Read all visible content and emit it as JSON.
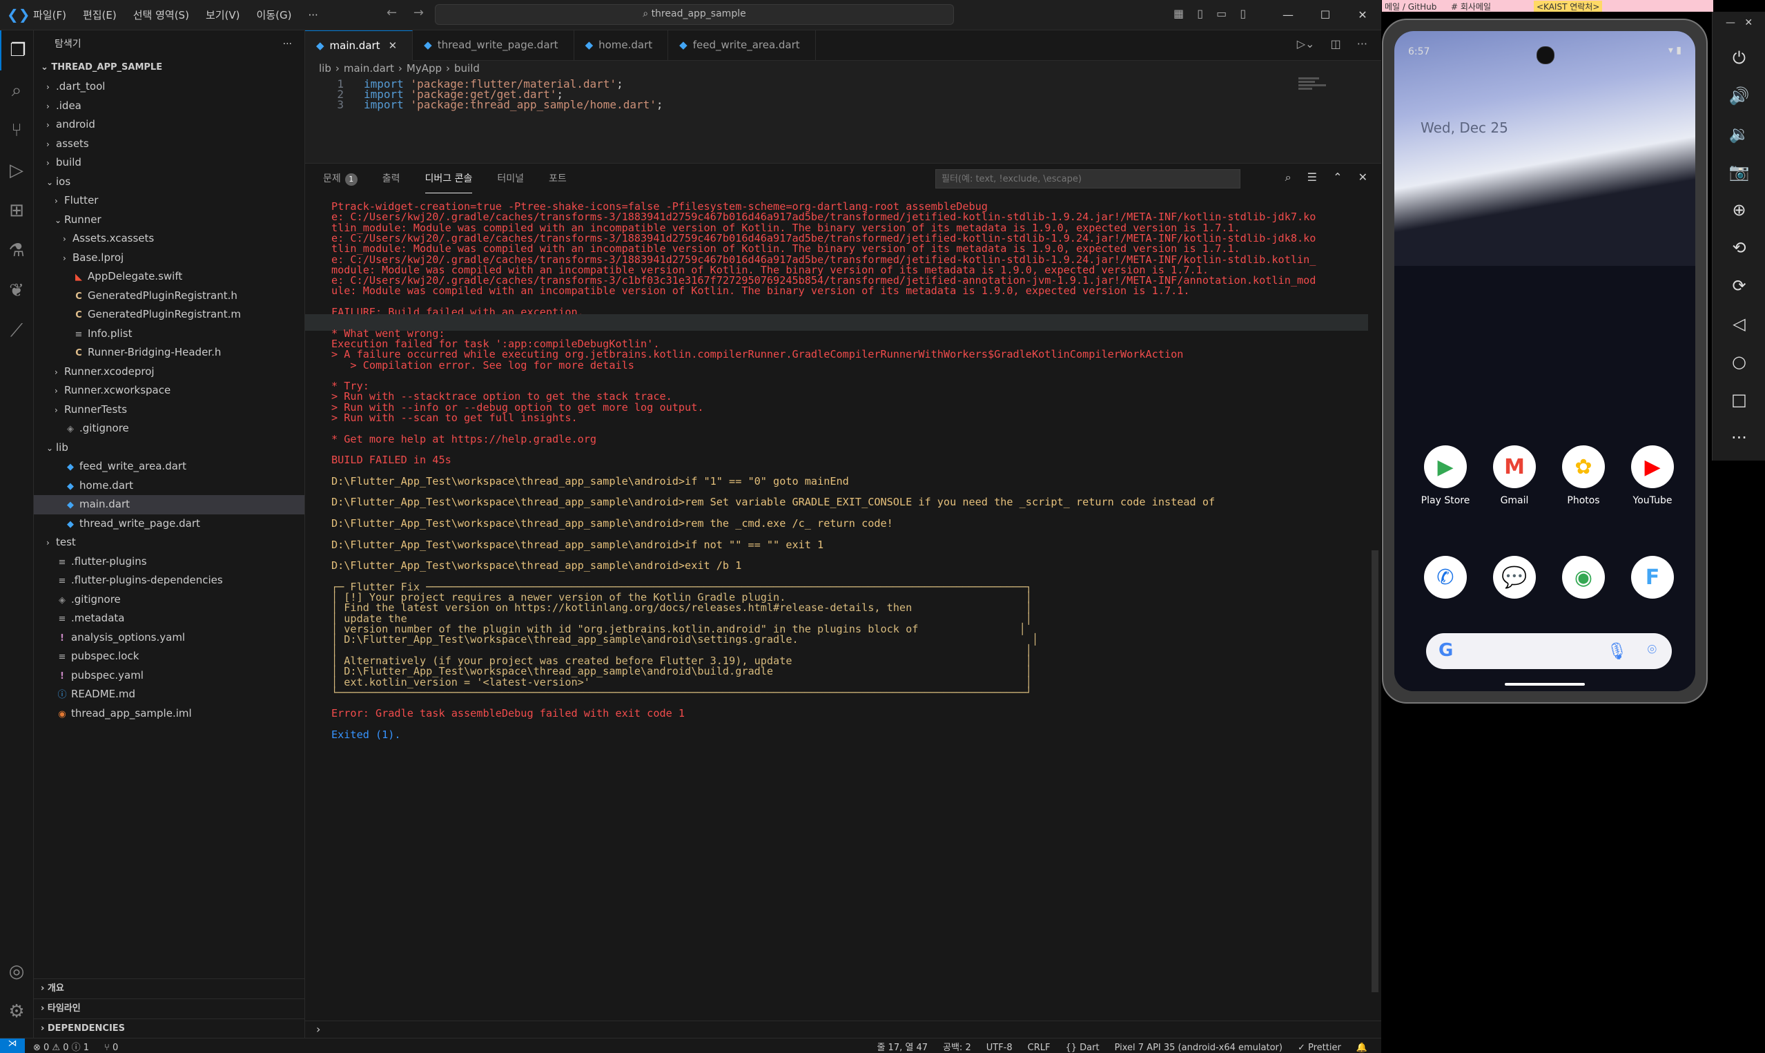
{
  "titlebar": {
    "menus": [
      "파일(F)",
      "편집(E)",
      "선택 영역(S)",
      "보기(V)",
      "이동(G)",
      "···"
    ],
    "search_text": "thread_app_sample"
  },
  "sidebar": {
    "header": "탐색기",
    "project": "THREAD_APP_SAMPLE",
    "items": [
      {
        "label": ".dart_tool",
        "depth": 0,
        "kind": "folder",
        "icon": "chevron-right-icon"
      },
      {
        "label": ".idea",
        "depth": 0,
        "kind": "folder",
        "icon": "chevron-right-icon"
      },
      {
        "label": "android",
        "depth": 0,
        "kind": "folder",
        "icon": "chevron-right-icon"
      },
      {
        "label": "assets",
        "depth": 0,
        "kind": "folder",
        "icon": "chevron-right-icon"
      },
      {
        "label": "build",
        "depth": 0,
        "kind": "folder",
        "icon": "chevron-right-icon"
      },
      {
        "label": "ios",
        "depth": 0,
        "kind": "folder-open",
        "icon": "chevron-down-icon"
      },
      {
        "label": "Flutter",
        "depth": 1,
        "kind": "folder",
        "icon": "chevron-right-icon"
      },
      {
        "label": "Runner",
        "depth": 1,
        "kind": "folder-open",
        "icon": "chevron-down-icon"
      },
      {
        "label": "Assets.xcassets",
        "depth": 2,
        "kind": "folder",
        "icon": "chevron-right-icon"
      },
      {
        "label": "Base.lproj",
        "depth": 2,
        "kind": "folder",
        "icon": "chevron-right-icon"
      },
      {
        "label": "AppDelegate.swift",
        "depth": 2,
        "kind": "swift",
        "icon": "swift-file-icon"
      },
      {
        "label": "GeneratedPluginRegistrant.h",
        "depth": 2,
        "kind": "c",
        "icon": "c-file-icon"
      },
      {
        "label": "GeneratedPluginRegistrant.m",
        "depth": 2,
        "kind": "c",
        "icon": "c-file-icon"
      },
      {
        "label": "Info.plist",
        "depth": 2,
        "kind": "lines",
        "icon": "plist-file-icon"
      },
      {
        "label": "Runner-Bridging-Header.h",
        "depth": 2,
        "kind": "c",
        "icon": "c-file-icon"
      },
      {
        "label": "Runner.xcodeproj",
        "depth": 1,
        "kind": "folder",
        "icon": "chevron-right-icon"
      },
      {
        "label": "Runner.xcworkspace",
        "depth": 1,
        "kind": "folder",
        "icon": "chevron-right-icon"
      },
      {
        "label": "RunnerTests",
        "depth": 1,
        "kind": "folder",
        "icon": "chevron-right-icon"
      },
      {
        "label": ".gitignore",
        "depth": 1,
        "kind": "git",
        "icon": "git-file-icon"
      },
      {
        "label": "lib",
        "depth": 0,
        "kind": "folder-open",
        "icon": "chevron-down-icon"
      },
      {
        "label": "feed_write_area.dart",
        "depth": 1,
        "kind": "dart",
        "icon": "dart-file-icon"
      },
      {
        "label": "home.dart",
        "depth": 1,
        "kind": "dart",
        "icon": "dart-file-icon"
      },
      {
        "label": "main.dart",
        "depth": 1,
        "kind": "dart",
        "icon": "dart-file-icon",
        "selected": true
      },
      {
        "label": "thread_write_page.dart",
        "depth": 1,
        "kind": "dart",
        "icon": "dart-file-icon"
      },
      {
        "label": "test",
        "depth": 0,
        "kind": "folder",
        "icon": "chevron-right-icon"
      },
      {
        "label": ".flutter-plugins",
        "depth": 0,
        "kind": "lines",
        "icon": "text-file-icon"
      },
      {
        "label": ".flutter-plugins-dependencies",
        "depth": 0,
        "kind": "lines",
        "icon": "text-file-icon"
      },
      {
        "label": ".gitignore",
        "depth": 0,
        "kind": "git",
        "icon": "git-file-icon"
      },
      {
        "label": ".metadata",
        "depth": 0,
        "kind": "lines",
        "icon": "text-file-icon"
      },
      {
        "label": "analysis_options.yaml",
        "depth": 0,
        "kind": "excl",
        "icon": "yaml-file-icon"
      },
      {
        "label": "pubspec.lock",
        "depth": 0,
        "kind": "lines",
        "icon": "text-file-icon"
      },
      {
        "label": "pubspec.yaml",
        "depth": 0,
        "kind": "excl",
        "icon": "yaml-file-icon"
      },
      {
        "label": "README.md",
        "depth": 0,
        "kind": "info",
        "icon": "info-file-icon"
      },
      {
        "label": "thread_app_sample.iml",
        "depth": 0,
        "kind": "rss",
        "icon": "iml-file-icon"
      }
    ],
    "bottom_sections": [
      "개요",
      "타임라인",
      "DEPENDENCIES"
    ]
  },
  "tabs": [
    {
      "label": "main.dart",
      "active": true
    },
    {
      "label": "thread_write_page.dart",
      "active": false
    },
    {
      "label": "home.dart",
      "active": false
    },
    {
      "label": "feed_write_area.dart",
      "active": false
    }
  ],
  "breadcrumb": [
    "lib",
    "main.dart",
    "MyApp",
    "build"
  ],
  "code_lines": [
    {
      "n": "1",
      "kw": "import",
      "str": "'package:flutter/material.dart'",
      "end": ";"
    },
    {
      "n": "2",
      "kw": "import",
      "str": "'package:get/get.dart'",
      "end": ";"
    },
    {
      "n": "3",
      "kw": "import",
      "str": "'package:thread_app_sample/home.dart'",
      "end": ";"
    }
  ],
  "panel": {
    "tabs": [
      "문제",
      "출력",
      "디버그 콘솔",
      "터미널",
      "포트"
    ],
    "problems_count": "1",
    "filter_placeholder": "필터(예: text, !exclude, \\escape)"
  },
  "console_lines": [
    {
      "t": "Ptrack-widget-creation=true -Ptree-shake-icons=false -Pfilesystem-scheme=org-dartlang-root assembleDebug",
      "c": "red"
    },
    {
      "t": "e: C:/Users/kwj20/.gradle/caches/transforms-3/1883941d2759c467b016d46a917ad5be/transformed/jetified-kotlin-stdlib-1.9.24.jar!/META-INF/kotlin-stdlib-jdk7.ko",
      "c": "red"
    },
    {
      "t": "tlin_module: Module was compiled with an incompatible version of Kotlin. The binary version of its metadata is 1.9.0, expected version is 1.7.1.",
      "c": "red"
    },
    {
      "t": "e: C:/Users/kwj20/.gradle/caches/transforms-3/1883941d2759c467b016d46a917ad5be/transformed/jetified-kotlin-stdlib-1.9.24.jar!/META-INF/kotlin-stdlib-jdk8.ko",
      "c": "red"
    },
    {
      "t": "tlin_module: Module was compiled with an incompatible version of Kotlin. The binary version of its metadata is 1.9.0, expected version is 1.7.1.",
      "c": "red"
    },
    {
      "t": "e: C:/Users/kwj20/.gradle/caches/transforms-3/1883941d2759c467b016d46a917ad5be/transformed/jetified-kotlin-stdlib-1.9.24.jar!/META-INF/kotlin-stdlib.kotlin_",
      "c": "red"
    },
    {
      "t": "module: Module was compiled with an incompatible version of Kotlin. The binary version of its metadata is 1.9.0, expected version is 1.7.1.",
      "c": "red"
    },
    {
      "t": "e: C:/Users/kwj20/.gradle/caches/transforms-3/c1bf03c31e3167f7272950769245b854/transformed/jetified-annotation-jvm-1.9.1.jar!/META-INF/annotation.kotlin_mod",
      "c": "red"
    },
    {
      "t": "ule: Module was compiled with an incompatible version of Kotlin. The binary version of its metadata is 1.9.0, expected version is 1.7.1.",
      "c": "red"
    },
    {
      "t": "",
      "c": "red"
    },
    {
      "t": "FAILURE: Build failed with an exception.",
      "c": "red"
    },
    {
      "t": "",
      "c": "red",
      "hl": true
    },
    {
      "t": "* What went wrong:",
      "c": "red"
    },
    {
      "t": "Execution failed for task ':app:compileDebugKotlin'.",
      "c": "red"
    },
    {
      "t": "> A failure occurred while executing org.jetbrains.kotlin.compilerRunner.GradleCompilerRunnerWithWorkers$GradleKotlinCompilerWorkAction",
      "c": "red"
    },
    {
      "t": "   > Compilation error. See log for more details",
      "c": "red"
    },
    {
      "t": "",
      "c": "red"
    },
    {
      "t": "* Try:",
      "c": "red"
    },
    {
      "t": "> Run with --stacktrace option to get the stack trace.",
      "c": "red"
    },
    {
      "t": "> Run with --info or --debug option to get more log output.",
      "c": "red"
    },
    {
      "t": "> Run with --scan to get full insights.",
      "c": "red"
    },
    {
      "t": "",
      "c": "red"
    },
    {
      "t": "* Get more help at https://help.gradle.org",
      "c": "red"
    },
    {
      "t": "",
      "c": "red"
    },
    {
      "t": "BUILD FAILED in 45s",
      "c": "red"
    },
    {
      "t": "",
      "c": "red"
    },
    {
      "t": "D:\\Flutter_App_Test\\workspace\\thread_app_sample\\android>if \"1\" == \"0\" goto mainEnd",
      "c": "yel"
    },
    {
      "t": "",
      "c": "yel"
    },
    {
      "t": "D:\\Flutter_App_Test\\workspace\\thread_app_sample\\android>rem Set variable GRADLE_EXIT_CONSOLE if you need the _script_ return code instead of",
      "c": "yel"
    },
    {
      "t": "",
      "c": "yel"
    },
    {
      "t": "D:\\Flutter_App_Test\\workspace\\thread_app_sample\\android>rem the _cmd.exe /c_ return code!",
      "c": "yel"
    },
    {
      "t": "",
      "c": "yel"
    },
    {
      "t": "D:\\Flutter_App_Test\\workspace\\thread_app_sample\\android>if not \"\" == \"\" exit 1",
      "c": "yel"
    },
    {
      "t": "",
      "c": "yel"
    },
    {
      "t": "D:\\Flutter_App_Test\\workspace\\thread_app_sample\\android>exit /b 1",
      "c": "yel"
    },
    {
      "t": "",
      "c": "yel"
    },
    {
      "t": "┌─ Flutter Fix ───────────────────────────────────────────────────────────────────────────────────────────────┐",
      "c": "yel2"
    },
    {
      "t": "│ [!] Your project requires a newer version of the Kotlin Gradle plugin.                                      │",
      "c": "yel2"
    },
    {
      "t": "│ Find the latest version on https://kotlinlang.org/docs/releases.html#release-details, then                  │",
      "c": "yel2"
    },
    {
      "t": "│ update the                                                                                                  │",
      "c": "yel2"
    },
    {
      "t": "│ version number of the plugin with id \"org.jetbrains.kotlin.android\" in the plugins block of                │",
      "c": "yel2"
    },
    {
      "t": "│ D:\\Flutter_App_Test\\workspace\\thread_app_sample\\android\\settings.gradle.                                     │",
      "c": "yel2"
    },
    {
      "t": "│                                                                                                             │",
      "c": "yel2"
    },
    {
      "t": "│ Alternatively (if your project was created before Flutter 3.19), update                                     │",
      "c": "yel2"
    },
    {
      "t": "│ D:\\Flutter_App_Test\\workspace\\thread_app_sample\\android\\build.gradle                                        │",
      "c": "yel2"
    },
    {
      "t": "│ ext.kotlin_version = '<latest-version>'                                                                     │",
      "c": "yel2"
    },
    {
      "t": "└─────────────────────────────────────────────────────────────────────────────────────────────────────────────┘",
      "c": "yel2"
    },
    {
      "t": "",
      "c": "red"
    },
    {
      "t": "Error: Gradle task assembleDebug failed with exit code 1",
      "c": "red"
    },
    {
      "t": "",
      "c": "red"
    },
    {
      "t": "Exited (1).",
      "c": "blue"
    }
  ],
  "statusbar": {
    "left": [
      "⊗ 0 ⚠ 0 ⓘ 1",
      "⑂ 0"
    ],
    "right": [
      "줄 17, 열 47",
      "공백: 2",
      "UTF-8",
      "CRLF",
      "{} Dart",
      "Pixel 7 API 35 (android-x64 emulator)",
      "✓ Prettier"
    ]
  },
  "bookmarks": [
    "메일 / GitHub",
    "# 회사메일",
    "<KAIST 연락처>"
  ],
  "phone": {
    "time": "6:57",
    "date": "Wed, Dec 25",
    "apps_row1": [
      {
        "label": "Play Store",
        "icon": "play-store-icon",
        "glyph": "▶",
        "color": "#34a853"
      },
      {
        "label": "Gmail",
        "icon": "gmail-icon",
        "glyph": "M",
        "color": "#ea4335"
      },
      {
        "label": "Photos",
        "icon": "photos-icon",
        "glyph": "✿",
        "color": "#fbbc05"
      },
      {
        "label": "YouTube",
        "icon": "youtube-icon",
        "glyph": "▶",
        "color": "#ff0000"
      }
    ],
    "apps_row2": [
      {
        "label": "",
        "icon": "phone-icon",
        "glyph": "✆",
        "color": "#1a73e8"
      },
      {
        "label": "",
        "icon": "messages-icon",
        "glyph": "💬",
        "color": "#1a73e8"
      },
      {
        "label": "",
        "icon": "chrome-icon",
        "glyph": "◉",
        "color": "#34a853"
      },
      {
        "label": "",
        "icon": "flutter-icon",
        "glyph": "F",
        "color": "#42a5f5"
      }
    ],
    "search_g": "G"
  },
  "emulator_toolbar": [
    "power-icon",
    "volume-up-icon",
    "volume-down-icon",
    "camera-icon",
    "zoom-icon",
    "rotate-left-icon",
    "rotate-right-icon",
    "back-icon",
    "home-icon",
    "overview-icon",
    "more-icon"
  ]
}
